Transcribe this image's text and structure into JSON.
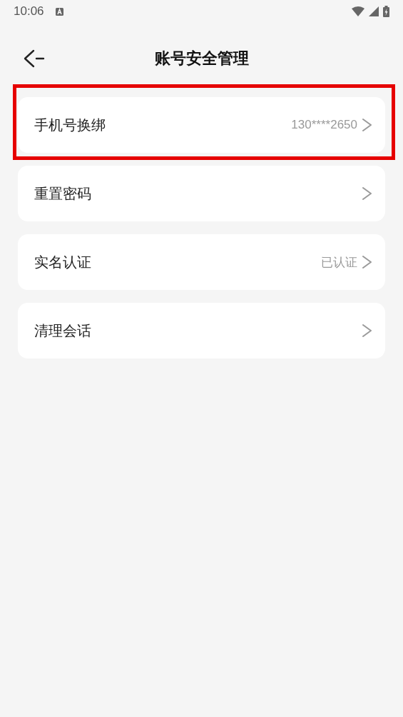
{
  "status_bar": {
    "time": "10:06"
  },
  "header": {
    "title": "账号安全管理"
  },
  "items": [
    {
      "label": "手机号换绑",
      "value": "130****2650",
      "highlighted": true
    },
    {
      "label": "重置密码",
      "highlighted": false
    },
    {
      "label": "实名认证",
      "value": "已认证",
      "highlighted": false
    },
    {
      "label": "清理会话",
      "highlighted": false
    }
  ]
}
